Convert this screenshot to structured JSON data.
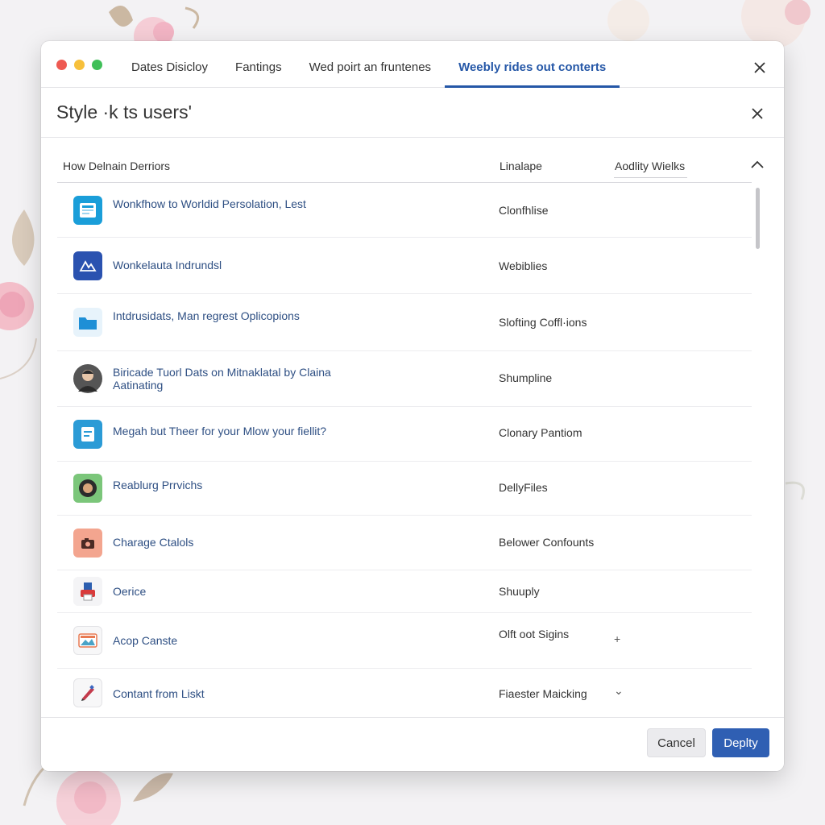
{
  "window": {
    "tabs": [
      {
        "label": "Dates Disicloy",
        "active": false
      },
      {
        "label": "Fantings",
        "active": false
      },
      {
        "label": "Wed poirt an fruntenes",
        "active": false
      },
      {
        "label": "Weebly rides out conterts",
        "active": true
      }
    ]
  },
  "dialog": {
    "title": "Style ·k ts users'",
    "columns": {
      "name": "How Delnain Derriors",
      "value": "Linalape",
      "sort": "Aodlity Wielks"
    },
    "rows": [
      {
        "title": "Wonkfhow to Worldid Persolation, Lest",
        "value": "Clonfhlise",
        "icon": "layout-icon",
        "color": "#1a9ed9"
      },
      {
        "title": "Wonkelauta Indrundsl",
        "value": "Webiblies",
        "icon": "sketch-icon",
        "color": "#2a52b0"
      },
      {
        "title": "Intdrusidats, Man regrest Oplicopions",
        "value": "Slofting Coffl·ions",
        "icon": "folder-icon",
        "color": "#1e8fd6"
      },
      {
        "title": "Biricade Tuorl Dats on Mitnaklatal by Claina Aatinating",
        "value": "Shumpline",
        "icon": "avatar-icon",
        "color": "#555555"
      },
      {
        "title": "Megah but Theer for your Mlow your fiellit?",
        "value": "Clonary Pantiom",
        "icon": "document-icon",
        "color": "#2b9bd6"
      },
      {
        "title": "Reablurg Prrvichs",
        "value": "DellyFiles",
        "icon": "badge-icon",
        "color": "#7bc67a"
      },
      {
        "title": "Charage Ctalols",
        "value": "Belower Confounts",
        "icon": "camera-icon",
        "color": "#f3a58f"
      },
      {
        "title": "Oerice",
        "value": "Shuuply",
        "icon": "printer-icon",
        "color": "#2d5fb0"
      },
      {
        "title": "Acop Canste",
        "value": "Olft oot Sigins",
        "icon": "image-icon",
        "color": "#e87a52",
        "extra": "+"
      },
      {
        "title": "Contant from Liskt",
        "value": "Fiaester Maicking",
        "icon": "pencil-icon",
        "color": "#c43b4c",
        "extra": "⌄"
      }
    ]
  },
  "footer": {
    "cancel_label": "Cancel",
    "primary_label": "Deplty"
  },
  "colors": {
    "accent": "#2557a7",
    "primary_button": "#2f5fb3",
    "close_red": "#ee5a52",
    "minimize_yellow": "#f7c03b",
    "maximize_green": "#3fbf58"
  }
}
